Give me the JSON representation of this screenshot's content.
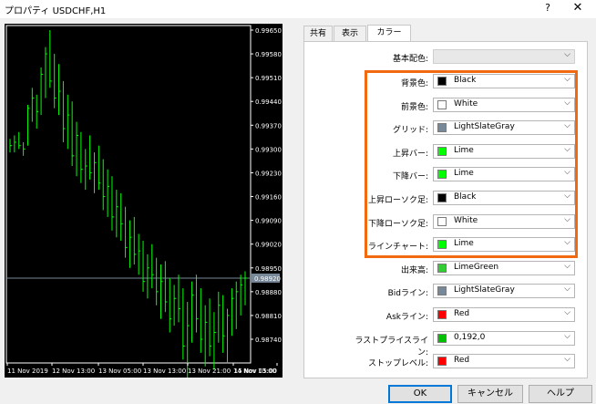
{
  "window": {
    "title": "プロパティ USDCHF,H1",
    "help_label": "?",
    "close_label": "✕"
  },
  "tabs": [
    {
      "label": "共有"
    },
    {
      "label": "表示"
    },
    {
      "label": "カラー"
    }
  ],
  "active_tab": "カラー",
  "base_scheme": {
    "label": "基本配色:",
    "value": ""
  },
  "color_rows": [
    {
      "label": "背景色:",
      "value": "Black",
      "color": "#000000"
    },
    {
      "label": "前景色:",
      "value": "White",
      "color": "#ffffff"
    },
    {
      "label": "グリッド:",
      "value": "LightSlateGray",
      "color": "#778899"
    },
    {
      "label": "上昇バー:",
      "value": "Lime",
      "color": "#00ff00"
    },
    {
      "label": "下降バー:",
      "value": "Lime",
      "color": "#00ff00"
    },
    {
      "label": "上昇ローソク足:",
      "value": "Black",
      "color": "#000000"
    },
    {
      "label": "下降ローソク足:",
      "value": "White",
      "color": "#ffffff"
    },
    {
      "label": "ラインチャート:",
      "value": "Lime",
      "color": "#00ff00"
    },
    {
      "label": "出来高:",
      "value": "LimeGreen",
      "color": "#32cd32"
    },
    {
      "label": "Bidライン:",
      "value": "LightSlateGray",
      "color": "#778899"
    },
    {
      "label": "Askライン:",
      "value": "Red",
      "color": "#ff0000"
    },
    {
      "label": "ラストプライスライン:",
      "value": "0,192,0",
      "color": "#00c000"
    },
    {
      "label": "ストップレベル:",
      "value": "Red",
      "color": "#ff0000"
    }
  ],
  "highlight_color": "#f26a10",
  "buttons": {
    "ok": "OK",
    "cancel": "キャンセル",
    "help": "ヘルプ"
  },
  "chart": {
    "price_labels": [
      "0.99650",
      "0.99580",
      "0.99510",
      "0.99440",
      "0.99370",
      "0.99300",
      "0.99230",
      "0.99160",
      "0.99090",
      "0.99020",
      "0.98950",
      "0.98880",
      "0.98810",
      "0.98740"
    ],
    "current_price": "0.98920",
    "time_labels": [
      "11 Nov 2019",
      "12 Nov 13:00",
      "13 Nov 05:00",
      "13 Nov 13:00",
      "13 Nov 21:00",
      "14 Nov 13:00",
      "15 Nov 05:00"
    ],
    "bars": [
      {
        "h": 0.9933,
        "l": 0.9929,
        "c": 0.9931
      },
      {
        "h": 0.9934,
        "l": 0.9929,
        "c": 0.9932
      },
      {
        "h": 0.9935,
        "l": 0.993,
        "c": 0.9931
      },
      {
        "h": 0.9932,
        "l": 0.9928,
        "c": 0.993
      },
      {
        "h": 0.9943,
        "l": 0.9931,
        "c": 0.9942
      },
      {
        "h": 0.9948,
        "l": 0.9938,
        "c": 0.9945
      },
      {
        "h": 0.9946,
        "l": 0.9936,
        "c": 0.9941
      },
      {
        "h": 0.9954,
        "l": 0.994,
        "c": 0.9952
      },
      {
        "h": 0.996,
        "l": 0.9945,
        "c": 0.9958
      },
      {
        "h": 0.9965,
        "l": 0.9948,
        "c": 0.995
      },
      {
        "h": 0.9958,
        "l": 0.9942,
        "c": 0.9945
      },
      {
        "h": 0.9955,
        "l": 0.994,
        "c": 0.9947
      },
      {
        "h": 0.995,
        "l": 0.9932,
        "c": 0.9936
      },
      {
        "h": 0.9946,
        "l": 0.993,
        "c": 0.994
      },
      {
        "h": 0.9944,
        "l": 0.9925,
        "c": 0.9928
      },
      {
        "h": 0.9938,
        "l": 0.9922,
        "c": 0.9934
      },
      {
        "h": 0.9935,
        "l": 0.992,
        "c": 0.9924
      },
      {
        "h": 0.993,
        "l": 0.9918,
        "c": 0.9925
      },
      {
        "h": 0.9934,
        "l": 0.9921,
        "c": 0.9923
      },
      {
        "h": 0.9929,
        "l": 0.9917,
        "c": 0.9926
      },
      {
        "h": 0.9931,
        "l": 0.9918,
        "c": 0.992
      },
      {
        "h": 0.9927,
        "l": 0.9912,
        "c": 0.9916
      },
      {
        "h": 0.9924,
        "l": 0.991,
        "c": 0.9919
      },
      {
        "h": 0.9922,
        "l": 0.9906,
        "c": 0.991
      },
      {
        "h": 0.9918,
        "l": 0.9904,
        "c": 0.9913
      },
      {
        "h": 0.9917,
        "l": 0.9903,
        "c": 0.9908
      },
      {
        "h": 0.9913,
        "l": 0.9898,
        "c": 0.9901
      },
      {
        "h": 0.9909,
        "l": 0.9895,
        "c": 0.9904
      },
      {
        "h": 0.991,
        "l": 0.9896,
        "c": 0.9899
      },
      {
        "h": 0.9905,
        "l": 0.9893,
        "c": 0.99
      },
      {
        "h": 0.9903,
        "l": 0.9888,
        "c": 0.9891
      },
      {
        "h": 0.9899,
        "l": 0.9886,
        "c": 0.9895
      },
      {
        "h": 0.9902,
        "l": 0.9889,
        "c": 0.9893
      },
      {
        "h": 0.9898,
        "l": 0.9884,
        "c": 0.9888
      },
      {
        "h": 0.9896,
        "l": 0.988,
        "c": 0.9891
      },
      {
        "h": 0.9897,
        "l": 0.9882,
        "c": 0.9885
      },
      {
        "h": 0.9892,
        "l": 0.9876,
        "c": 0.988
      },
      {
        "h": 0.989,
        "l": 0.9878,
        "c": 0.9886
      },
      {
        "h": 0.9893,
        "l": 0.9879,
        "c": 0.9883
      },
      {
        "h": 0.9889,
        "l": 0.9868,
        "c": 0.9872
      },
      {
        "h": 0.9885,
        "l": 0.9862,
        "c": 0.9878
      },
      {
        "h": 0.9891,
        "l": 0.9873,
        "c": 0.9887
      },
      {
        "h": 0.9893,
        "l": 0.9876,
        "c": 0.988
      },
      {
        "h": 0.9889,
        "l": 0.987,
        "c": 0.9874
      },
      {
        "h": 0.9884,
        "l": 0.9866,
        "c": 0.9879
      },
      {
        "h": 0.9886,
        "l": 0.9869,
        "c": 0.9872
      },
      {
        "h": 0.9882,
        "l": 0.9865,
        "c": 0.9876
      },
      {
        "h": 0.9888,
        "l": 0.9873,
        "c": 0.9884
      },
      {
        "h": 0.9887,
        "l": 0.987,
        "c": 0.9875
      },
      {
        "h": 0.9883,
        "l": 0.9867,
        "c": 0.9881
      },
      {
        "h": 0.9889,
        "l": 0.9875,
        "c": 0.9886
      },
      {
        "h": 0.9891,
        "l": 0.9877,
        "c": 0.9888
      },
      {
        "h": 0.9893,
        "l": 0.9881,
        "c": 0.989
      },
      {
        "h": 0.9894,
        "l": 0.9884,
        "c": 0.9892
      }
    ]
  }
}
